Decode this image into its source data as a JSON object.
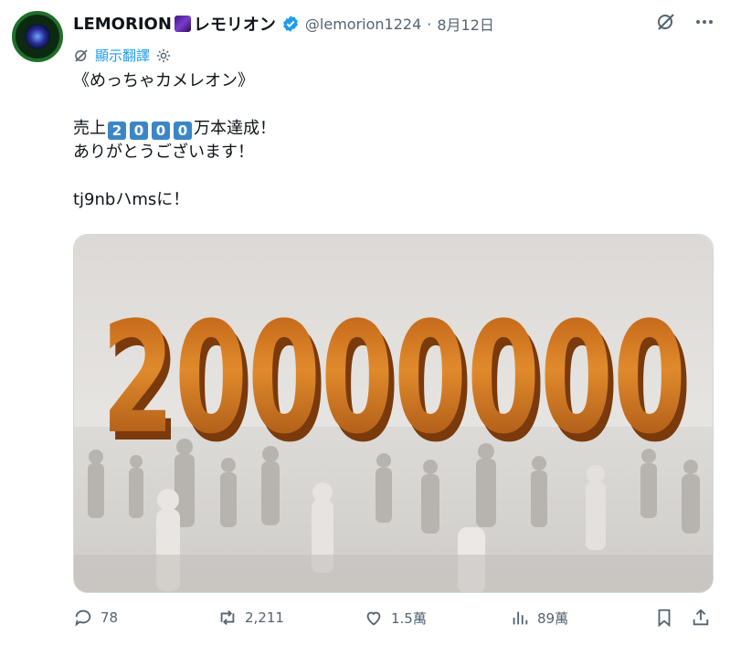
{
  "author": {
    "display_name": "LEMORION",
    "display_name_suffix": "レモリオン",
    "handle": "@lemorion1224",
    "separator": "·",
    "date": "8月12日"
  },
  "translate_label": "顯示翻譯",
  "tweet": {
    "line1": "《めっちゃカメレオン》",
    "line2_prefix": "売上",
    "line2_digits": [
      "2",
      "0",
      "0",
      "0"
    ],
    "line2_suffix": "万本達成！",
    "line3": "ありがとうございます！",
    "line4": "tj9nbハmsに！"
  },
  "media": {
    "big_number": "20000000"
  },
  "actions": {
    "reply_count": "78",
    "retweet_count": "2,211",
    "like_count": "1.5萬",
    "views_count": "89萬"
  },
  "colors": {
    "accent": "#1d9bf0",
    "muted": "#536471",
    "digit_box": "#3b86c7",
    "number_orange": "#d2741f"
  }
}
